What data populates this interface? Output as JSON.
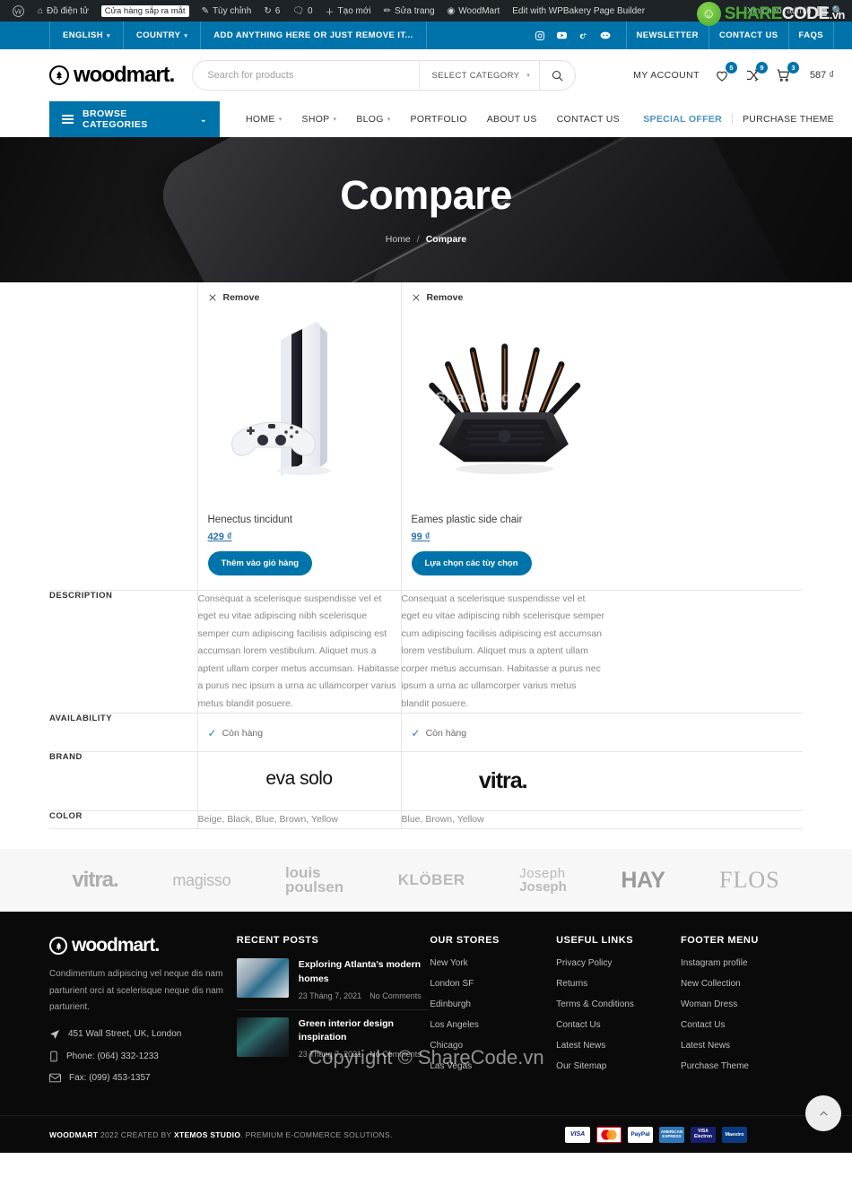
{
  "adminbar": {
    "logo_icon": "wordpress-icon",
    "items": [
      {
        "icon": "home-icon",
        "label": "Đồ điện tử"
      },
      {
        "icon": "",
        "label": "Cửa hàng sắp ra mắt",
        "badge": true
      },
      {
        "icon": "pencil-icon",
        "label": "Tùy chỉnh"
      },
      {
        "icon": "refresh-icon",
        "label": "6"
      },
      {
        "icon": "comment-icon",
        "label": "0"
      },
      {
        "icon": "plus-icon",
        "label": "Tạo mới"
      },
      {
        "icon": "edit-icon",
        "label": "Sửa trang"
      },
      {
        "icon": "woodmart-icon",
        "label": "WoodMart"
      },
      {
        "icon": "",
        "label": "Edit with WPBakery Page Builder"
      }
    ],
    "greeting": "Xin chào, admin",
    "search_icon": "search-icon"
  },
  "watermark": {
    "share": "SHARE",
    "code": "CODE",
    "vn": ".vn",
    "mid": "ShareCode.vn",
    "copyright": "Copyright © ShareCode.vn"
  },
  "topbar": {
    "language": "ENGLISH",
    "country": "COUNTRY",
    "promo": "ADD ANYTHING HERE OR JUST REMOVE IT...",
    "socials": [
      "instagram-icon",
      "youtube-icon",
      "tiktok-icon",
      "discord-icon"
    ],
    "links": [
      "NEWSLETTER",
      "CONTACT US",
      "FAQS"
    ]
  },
  "header": {
    "logo": "woodmart.",
    "search": {
      "placeholder": "Search for products",
      "value": "",
      "category": "SELECT CATEGORY"
    },
    "my_account": "MY ACCOUNT",
    "wishlist_count": "5",
    "compare_count": "9",
    "cart_count": "3",
    "cart_amount": "587 ₫"
  },
  "nav": {
    "browse": "BROWSE CATEGORIES",
    "items": [
      {
        "label": "HOME",
        "caret": true
      },
      {
        "label": "SHOP",
        "caret": true
      },
      {
        "label": "BLOG",
        "caret": true
      },
      {
        "label": "PORTFOLIO",
        "caret": false
      },
      {
        "label": "ABOUT US",
        "caret": false
      },
      {
        "label": "CONTACT US",
        "caret": false
      }
    ],
    "special_offer": "SPECIAL OFFER",
    "purchase_theme": "PURCHASE THEME"
  },
  "hero": {
    "title": "Compare",
    "breadcrumb_home": "Home",
    "breadcrumb_sep": "/",
    "breadcrumb_current": "Compare"
  },
  "compare": {
    "remove_label": "Remove",
    "rows": [
      {
        "label": "DESCRIPTION"
      },
      {
        "label": "AVAILABILITY"
      },
      {
        "label": "BRAND"
      },
      {
        "label": "COLOR"
      }
    ],
    "products": [
      {
        "name": "Henectus tincidunt",
        "price": "429 ₫",
        "button": "Thêm vào giỏ hàng",
        "image": "playstation-console-image",
        "description": "Consequat a scelerisque suspendisse vel et eget eu vitae adipiscing nibh scelerisque semper cum adipiscing facilisis adipiscing est accumsan lorem vestibulum. Aliquet mus a aptent ullam corper metus accumsan. Habitasse a purus nec ipsum a urna ac ullamcorper varius metus blandit posuere.",
        "availability": "Còn hàng",
        "brand": "eva solo",
        "color": "Beige, Black, Blue, Brown, Yellow"
      },
      {
        "name": "Eames plastic side chair",
        "price": "99 ₫",
        "button": "Lựa chọn các tùy chọn",
        "image": "wifi-router-image",
        "description": "Consequat a scelerisque suspendisse vel et eget eu vitae adipiscing nibh scelerisque semper cum adipiscing facilisis adipiscing est accumsan lorem vestibulum. Aliquet mus a aptent ullam corper metus accumsan. Habitasse a purus nec ipsum a urna ac ullamcorper varius metus blandit posuere.",
        "availability": "Còn hàng",
        "brand": "vitra.",
        "color": "Blue, Brown, Yellow"
      }
    ]
  },
  "brands": [
    {
      "name": "vitra.",
      "style": "vitra"
    },
    {
      "name": "magisso",
      "style": "magisso"
    },
    {
      "name": "louis poulsen",
      "style": "louis"
    },
    {
      "name": "KLÖBER",
      "style": "klober"
    },
    {
      "name": "Joseph Joseph",
      "style": "joseph"
    },
    {
      "name": "HAY",
      "style": "hay"
    },
    {
      "name": "FLOS",
      "style": "flos"
    }
  ],
  "footer": {
    "logo": "woodmart.",
    "about": "Condimentum adipiscing vel neque dis nam parturient orci at scelerisque neque dis nam parturient.",
    "address": "451 Wall Street, UK, London",
    "phone": "Phone: (064) 332-1233",
    "fax": "Fax: (099) 453-1357",
    "recent_posts_head": "RECENT POSTS",
    "posts": [
      {
        "title": "Exploring Atlanta's modern homes",
        "date": "23 Tháng 7, 2021",
        "comments": "No Comments"
      },
      {
        "title": "Green interior design inspiration",
        "date": "23 Tháng 7, 2021",
        "comments": "No Comments"
      }
    ],
    "stores_head": "OUR STORES",
    "stores": [
      "New York",
      "London SF",
      "Edinburgh",
      "Los Angeles",
      "Chicago",
      "Las Vegas"
    ],
    "links_head": "USEFUL LINKS",
    "links": [
      "Privacy Policy",
      "Returns",
      "Terms & Conditions",
      "Contact Us",
      "Latest News",
      "Our Sitemap"
    ],
    "menu_head": "FOOTER MENU",
    "menu": [
      "Instagram profile",
      "New Collection",
      "Woman Dress",
      "Contact Us",
      "Latest News",
      "Purchase Theme"
    ],
    "copyright_pre": "WOODMART",
    "copyright_mid": " 2022 CREATED BY ",
    "copyright_brand": "XTEMOS STUDIO",
    "copyright_post": ". PREMIUM E-COMMERCE SOLUTIONS.",
    "payments": [
      "VISA",
      "MasterCard",
      "PayPal",
      "AMERICAN EXPRESS",
      "VISA Electron",
      "Maestro"
    ],
    "scroll_top_icon": "chevron-up-icon"
  },
  "colors": {
    "accent": "#0073aa",
    "admin_bar": "#1d2327",
    "footer_bg": "#0a0a0a",
    "hero_bg": "#141414"
  }
}
